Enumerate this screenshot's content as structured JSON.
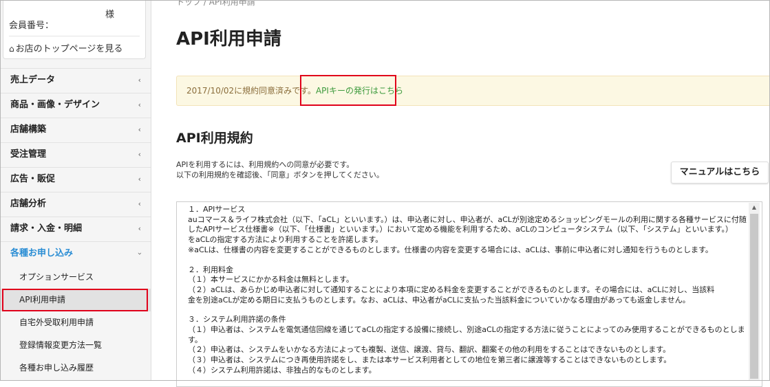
{
  "member": {
    "honorific": "様",
    "member_no_label": "会員番号：",
    "shop_top_link": "お店のトップページを見る"
  },
  "menu": [
    {
      "label": "売上データ"
    },
    {
      "label": "商品・画像・デザイン"
    },
    {
      "label": "店舗構築"
    },
    {
      "label": "受注管理"
    },
    {
      "label": "広告・販促"
    },
    {
      "label": "店舗分析"
    },
    {
      "label": "請求・入金・明細"
    },
    {
      "label": "各種お申し込み",
      "active": true
    }
  ],
  "submenu": [
    {
      "label": "オプションサービス"
    },
    {
      "label": "API利用申請",
      "current": true
    },
    {
      "label": "自宅外受取利用申請"
    },
    {
      "label": "登録情報変更方法一覧"
    },
    {
      "label": "各種お申し込み履歴"
    }
  ],
  "breadcrumb": {
    "home": "トップ",
    "sep": "/",
    "current": "API利用申請"
  },
  "page_title": "API利用申請",
  "alert": {
    "text": "2017/10/02に規約同意済みです。",
    "link": "APIキーの発行はこちら"
  },
  "section_title": "API利用規約",
  "intro": {
    "line1": "APIを利用するには、利用規約への同意が必要です。",
    "line2": "以下の利用規約を確認後、「同意」ボタンを押してください。"
  },
  "manual_button": "マニュアルはこちら",
  "terms": [
    "１．APIサービス",
    "auコマース＆ライフ株式会社（以下、「aCL」といいます。）は、申込者に対し、申込者が、aCLが別途定めるショッピングモールの利用に関する各種サービスに付随",
    "したAPIサービス仕様書※（以下、「仕様書」といいます。）において定める機能を利用するため、aCLのコンピュータシステム（以下、「システム」といいます。）",
    "をaCLの指定する方法により利用することを許諾します。",
    "※aCLは、仕様書の内容を変更することができるものとします。仕様書の内容を変更する場合には、aCLは、事前に申込者に対し通知を行うものとします。",
    "",
    "２．利用料金",
    "（１）本サービスにかかる料金は無料とします。",
    "（２）aCLは、あらかじめ申込者に対して通知することにより本項に定める料金を変更することができるものとします。その場合には、aCLに対し、当該料",
    "金を別途aCLが定める期日に支払うものとします。なお、aCLは、申込者がaCLに支払った当該料金についていかなる理由があっても返金しません。",
    "",
    "３．システム利用許諾の条件",
    "（１）申込者は、システムを電気通信回線を通じてaCLの指定する設備に接続し、別途aCLの指定する方法に従うことによってのみ使用することができるものとしま",
    "す。",
    "（２）申込者は、システムをいかなる方法によっても複製、送信、譲渡、貸与、翻訳、翻案その他の利用をすることはできないものとします。",
    "（３）申込者は、システムにつき再使用許諾をし、または本サービス利用者としての地位を第三者に譲渡等することはできないものとします。",
    "（４）システム利用許諾は、非独占的なものとします。"
  ]
}
